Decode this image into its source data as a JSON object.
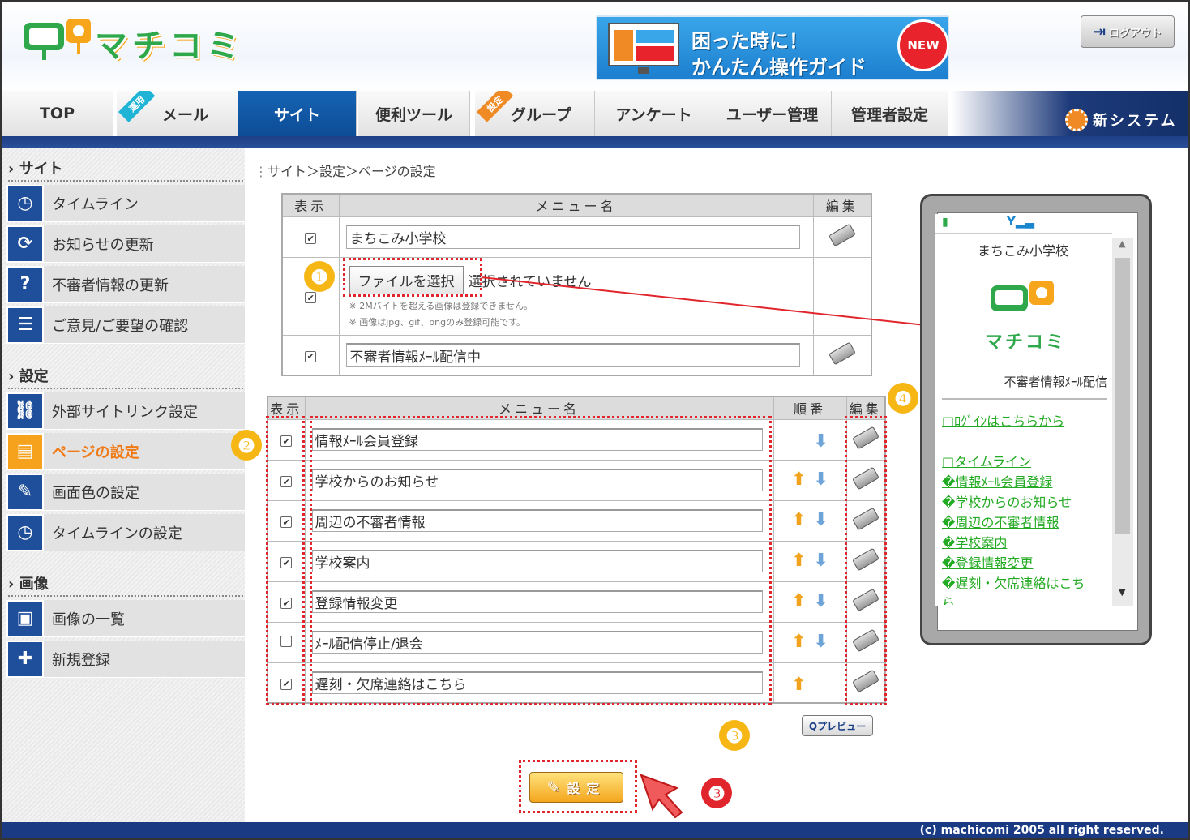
{
  "header": {
    "logo_text": "マチコミ",
    "banner_line1": "困った時に！",
    "banner_line2": "かんたん操作ガイド",
    "banner_badge": "NEW",
    "logout_label": "ログアウト"
  },
  "nav": {
    "tabs": [
      "TOP",
      "メール",
      "サイト",
      "便利ツール",
      "グループ",
      "アンケート",
      "ユーザー管理",
      "管理者設定"
    ],
    "ribbon_mail": "運用",
    "ribbon_group": "設定",
    "new_system": "新システム"
  },
  "sidebar": {
    "sections": [
      "サイト",
      "設定",
      "画像"
    ],
    "items": [
      "タイムライン",
      "お知らせの更新",
      "不審者情報の更新",
      "ご意見/ご要望の確認",
      "外部サイトリンク設定",
      "ページの設定",
      "画面色の設定",
      "タイムラインの設定",
      "画像の一覧",
      "新規登録"
    ]
  },
  "breadcrumb": "サイト＞設定＞ページの設定",
  "table1": {
    "col_show": "表示",
    "col_name": "メニュー名",
    "col_edit": "編集",
    "row1_value": "まちこみ小学校",
    "file_button": "ファイルを選択",
    "file_status": "選択されていません",
    "note1": "※ 2Mバイトを超える画像は登録できません。",
    "note2": "※ 画像はjpg、gif、pngのみ登録可能です。",
    "row3_value": "不審者情報ﾒｰﾙ配信中"
  },
  "table2": {
    "col_show": "表示",
    "col_name": "メニュー名",
    "col_order": "順番",
    "col_edit": "編集",
    "rows": [
      {
        "name": "情報ﾒｰﾙ会員登録",
        "checked": true
      },
      {
        "name": "学校からのお知らせ",
        "checked": true
      },
      {
        "name": "周辺の不審者情報",
        "checked": true
      },
      {
        "name": "学校案内",
        "checked": true
      },
      {
        "name": "登録情報変更",
        "checked": true
      },
      {
        "name": "ﾒｰﾙ配信停止/退会",
        "checked": false
      },
      {
        "name": "遅刻・欠席連絡はこちら",
        "checked": true
      }
    ]
  },
  "badges": {
    "b1": "❶",
    "b2": "❷",
    "b3": "❸",
    "b4": "❹"
  },
  "check_mark": "✔",
  "preview_label": "Qプレビュー",
  "set_label": "設定",
  "phone": {
    "title": "まちこみ小学校",
    "logo_text": "マチコミ",
    "subtitle": "不審者情報ﾒｰﾙ配信",
    "links": [
      "□ﾛｸﾞｲﾝはこちらから",
      "□タイムライン",
      "�情報ﾒｰﾙ会員登録",
      "�学校からのお知らせ",
      "�周辺の不審者情報",
      "�学校案内",
      "�登録情報変更",
      "�遅刻・欠席連絡はこち",
      "ら"
    ]
  },
  "footer": "(c) machicomi 2005 all right reserved."
}
